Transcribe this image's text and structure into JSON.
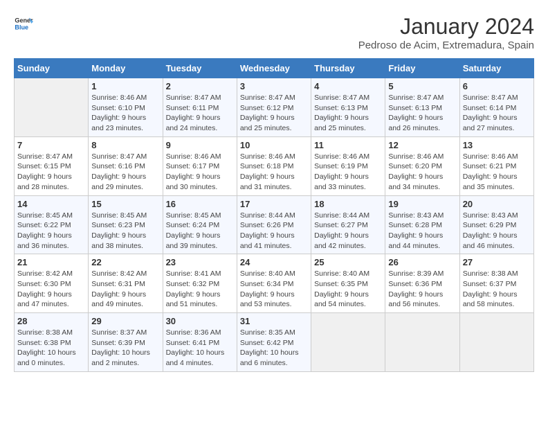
{
  "logo": {
    "text_general": "General",
    "text_blue": "Blue"
  },
  "header": {
    "title": "January 2024",
    "subtitle": "Pedroso de Acim, Extremadura, Spain"
  },
  "weekdays": [
    "Sunday",
    "Monday",
    "Tuesday",
    "Wednesday",
    "Thursday",
    "Friday",
    "Saturday"
  ],
  "weeks": [
    [
      {
        "day": "",
        "sunrise": "",
        "sunset": "",
        "daylight": ""
      },
      {
        "day": "1",
        "sunrise": "Sunrise: 8:46 AM",
        "sunset": "Sunset: 6:10 PM",
        "daylight": "Daylight: 9 hours and 23 minutes."
      },
      {
        "day": "2",
        "sunrise": "Sunrise: 8:47 AM",
        "sunset": "Sunset: 6:11 PM",
        "daylight": "Daylight: 9 hours and 24 minutes."
      },
      {
        "day": "3",
        "sunrise": "Sunrise: 8:47 AM",
        "sunset": "Sunset: 6:12 PM",
        "daylight": "Daylight: 9 hours and 25 minutes."
      },
      {
        "day": "4",
        "sunrise": "Sunrise: 8:47 AM",
        "sunset": "Sunset: 6:13 PM",
        "daylight": "Daylight: 9 hours and 25 minutes."
      },
      {
        "day": "5",
        "sunrise": "Sunrise: 8:47 AM",
        "sunset": "Sunset: 6:13 PM",
        "daylight": "Daylight: 9 hours and 26 minutes."
      },
      {
        "day": "6",
        "sunrise": "Sunrise: 8:47 AM",
        "sunset": "Sunset: 6:14 PM",
        "daylight": "Daylight: 9 hours and 27 minutes."
      }
    ],
    [
      {
        "day": "7",
        "sunrise": "",
        "sunset": "",
        "daylight": ""
      },
      {
        "day": "8",
        "sunrise": "Sunrise: 8:47 AM",
        "sunset": "Sunset: 6:16 PM",
        "daylight": "Daylight: 9 hours and 29 minutes."
      },
      {
        "day": "9",
        "sunrise": "Sunrise: 8:46 AM",
        "sunset": "Sunset: 6:17 PM",
        "daylight": "Daylight: 9 hours and 30 minutes."
      },
      {
        "day": "10",
        "sunrise": "Sunrise: 8:46 AM",
        "sunset": "Sunset: 6:18 PM",
        "daylight": "Daylight: 9 hours and 31 minutes."
      },
      {
        "day": "11",
        "sunrise": "Sunrise: 8:46 AM",
        "sunset": "Sunset: 6:19 PM",
        "daylight": "Daylight: 9 hours and 33 minutes."
      },
      {
        "day": "12",
        "sunrise": "Sunrise: 8:46 AM",
        "sunset": "Sunset: 6:20 PM",
        "daylight": "Daylight: 9 hours and 34 minutes."
      },
      {
        "day": "13",
        "sunrise": "Sunrise: 8:46 AM",
        "sunset": "Sunset: 6:21 PM",
        "daylight": "Daylight: 9 hours and 35 minutes."
      }
    ],
    [
      {
        "day": "14",
        "sunrise": "",
        "sunset": "",
        "daylight": ""
      },
      {
        "day": "15",
        "sunrise": "Sunrise: 8:45 AM",
        "sunset": "Sunset: 6:23 PM",
        "daylight": "Daylight: 9 hours and 38 minutes."
      },
      {
        "day": "16",
        "sunrise": "Sunrise: 8:45 AM",
        "sunset": "Sunset: 6:24 PM",
        "daylight": "Daylight: 9 hours and 39 minutes."
      },
      {
        "day": "17",
        "sunrise": "Sunrise: 8:44 AM",
        "sunset": "Sunset: 6:26 PM",
        "daylight": "Daylight: 9 hours and 41 minutes."
      },
      {
        "day": "18",
        "sunrise": "Sunrise: 8:44 AM",
        "sunset": "Sunset: 6:27 PM",
        "daylight": "Daylight: 9 hours and 42 minutes."
      },
      {
        "day": "19",
        "sunrise": "Sunrise: 8:43 AM",
        "sunset": "Sunset: 6:28 PM",
        "daylight": "Daylight: 9 hours and 44 minutes."
      },
      {
        "day": "20",
        "sunrise": "Sunrise: 8:43 AM",
        "sunset": "Sunset: 6:29 PM",
        "daylight": "Daylight: 9 hours and 46 minutes."
      }
    ],
    [
      {
        "day": "21",
        "sunrise": "",
        "sunset": "",
        "daylight": ""
      },
      {
        "day": "22",
        "sunrise": "Sunrise: 8:42 AM",
        "sunset": "Sunset: 6:31 PM",
        "daylight": "Daylight: 9 hours and 49 minutes."
      },
      {
        "day": "23",
        "sunrise": "Sunrise: 8:41 AM",
        "sunset": "Sunset: 6:32 PM",
        "daylight": "Daylight: 9 hours and 51 minutes."
      },
      {
        "day": "24",
        "sunrise": "Sunrise: 8:40 AM",
        "sunset": "Sunset: 6:34 PM",
        "daylight": "Daylight: 9 hours and 53 minutes."
      },
      {
        "day": "25",
        "sunrise": "Sunrise: 8:40 AM",
        "sunset": "Sunset: 6:35 PM",
        "daylight": "Daylight: 9 hours and 54 minutes."
      },
      {
        "day": "26",
        "sunrise": "Sunrise: 8:39 AM",
        "sunset": "Sunset: 6:36 PM",
        "daylight": "Daylight: 9 hours and 56 minutes."
      },
      {
        "day": "27",
        "sunrise": "Sunrise: 8:38 AM",
        "sunset": "Sunset: 6:37 PM",
        "daylight": "Daylight: 9 hours and 58 minutes."
      }
    ],
    [
      {
        "day": "28",
        "sunrise": "Sunrise: 8:38 AM",
        "sunset": "Sunset: 6:38 PM",
        "daylight": "Daylight: 10 hours and 0 minutes."
      },
      {
        "day": "29",
        "sunrise": "Sunrise: 8:37 AM",
        "sunset": "Sunset: 6:39 PM",
        "daylight": "Daylight: 10 hours and 2 minutes."
      },
      {
        "day": "30",
        "sunrise": "Sunrise: 8:36 AM",
        "sunset": "Sunset: 6:41 PM",
        "daylight": "Daylight: 10 hours and 4 minutes."
      },
      {
        "day": "31",
        "sunrise": "Sunrise: 8:35 AM",
        "sunset": "Sunset: 6:42 PM",
        "daylight": "Daylight: 10 hours and 6 minutes."
      },
      {
        "day": "",
        "sunrise": "",
        "sunset": "",
        "daylight": ""
      },
      {
        "day": "",
        "sunrise": "",
        "sunset": "",
        "daylight": ""
      },
      {
        "day": "",
        "sunrise": "",
        "sunset": "",
        "daylight": ""
      }
    ]
  ],
  "week1_sunday": {
    "day": "7",
    "sunrise": "Sunrise: 8:47 AM",
    "sunset": "Sunset: 6:15 PM",
    "daylight": "Daylight: 9 hours and 28 minutes."
  },
  "week2_sunday": {
    "day": "14",
    "sunrise": "Sunrise: 8:45 AM",
    "sunset": "Sunset: 6:22 PM",
    "daylight": "Daylight: 9 hours and 36 minutes."
  },
  "week3_sunday": {
    "day": "21",
    "sunrise": "Sunrise: 8:42 AM",
    "sunset": "Sunset: 6:30 PM",
    "daylight": "Daylight: 9 hours and 47 minutes."
  }
}
